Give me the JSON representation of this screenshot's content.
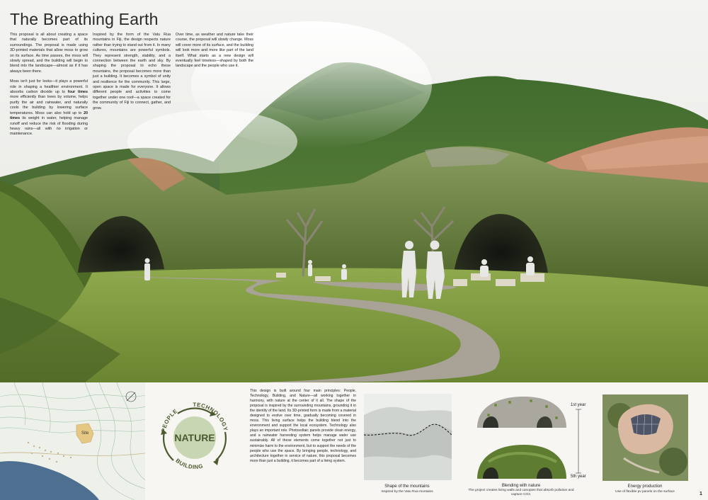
{
  "title": "The Breathing Earth",
  "intro": {
    "col1_p1": "This proposal is all about creating a space that naturally becomes part of its surroundings. The proposal is made using 3D-printed materials that allow moss to grow on its surface. As time passes, the moss will slowly spread, and the building will begin to blend into the landscape—almost as if it has always been there.",
    "col1_p2_a": "Moss isn't just for looks—it plays a powerful role in shaping a healthier environment. It absorbs carbon dioxide up to ",
    "col1_p2_b1": "four times",
    "col1_p2_c": " more efficiently than trees by volume, helps purify the air and rainwater, and naturally cools the building by lowering surface temperatures. Moss can also hold up to ",
    "col1_p2_b2": "20 times",
    "col1_p2_d": " its weight in water, helping manage runoff and reduce the risk of flooding during heavy rains—all with no irrigation or maintenance.",
    "col2_p1": "Inspired by the form of the Vatu Rua mountains in Fiji, the design respects nature rather than trying to stand out from it. In many cultures, mountains are powerful symbols. They represent strength, stability, and a connection between the earth and sky. By shaping the proposal to echo these mountains, the proposal becomes more than just a building. It becomes a symbol of unity and resilience for the community. This large, open space is made for everyone. It allows different people and activities to come together under one roof—a space created for the community of Fiji to connect, gather, and grow.",
    "col3_p1": "Over time, as weather and nature take their course, the proposal will slowly change. Moss will cover more of its surface, and the building will look more and more like part of the land itself. What starts as a new design will eventually feel timeless—shaped by both the landscape and the people who use it."
  },
  "map": {
    "site_label": "Site"
  },
  "nature_diagram": {
    "center": "NATURE",
    "people": "PEOPLE",
    "technology": "TECHNOLOGY",
    "building": "BUILDING"
  },
  "principles_text": "This design is built around four main principles: People, Technology, Building, and Nature—all working together in harmony, with nature at the center of it all. The shape of the proposal is inspired by the surrounding mountains, grounding it in the identity of the land. Its 3D-printed form is made from a material designed to evolve over time, gradually becoming covered in moss. This living surface helps the building blend into the environment and support the local ecosystem. Technology also plays an important role. Photovoltaic panels provide clean energy, and a rainwater harvesting system helps manage water use sustainably. All of these elements come together not just to minimize harm to the environment, but to support the needs of the people who use the space. By bringing people, technology, and architecture together in service of nature, this proposal becomes more than just a building, it becomes part of a living system.",
  "figures": {
    "shape": {
      "caption": "Shape of the mountains",
      "sub": "Inspired by the Vatu Rua montains"
    },
    "blend": {
      "caption": "Blending with nature",
      "sub": "The project creates living walls and canopies that absorb pollution and capture CO2.",
      "label_top": "1st year",
      "label_bottom": "5th year"
    },
    "energy": {
      "caption": "Energy production",
      "sub": "Use of flexible pv panels on the surface"
    }
  },
  "page_number": "1",
  "colors": {
    "moss": "#5f7a34",
    "moss_dark": "#3f5522",
    "lawn": "#7f9a3e",
    "path": "#a29b8d",
    "sky": "#eef0ec",
    "diagram_ring": "#c9d6b3",
    "diagram_text": "#4b5a2e",
    "water": "#4e6f8f"
  }
}
